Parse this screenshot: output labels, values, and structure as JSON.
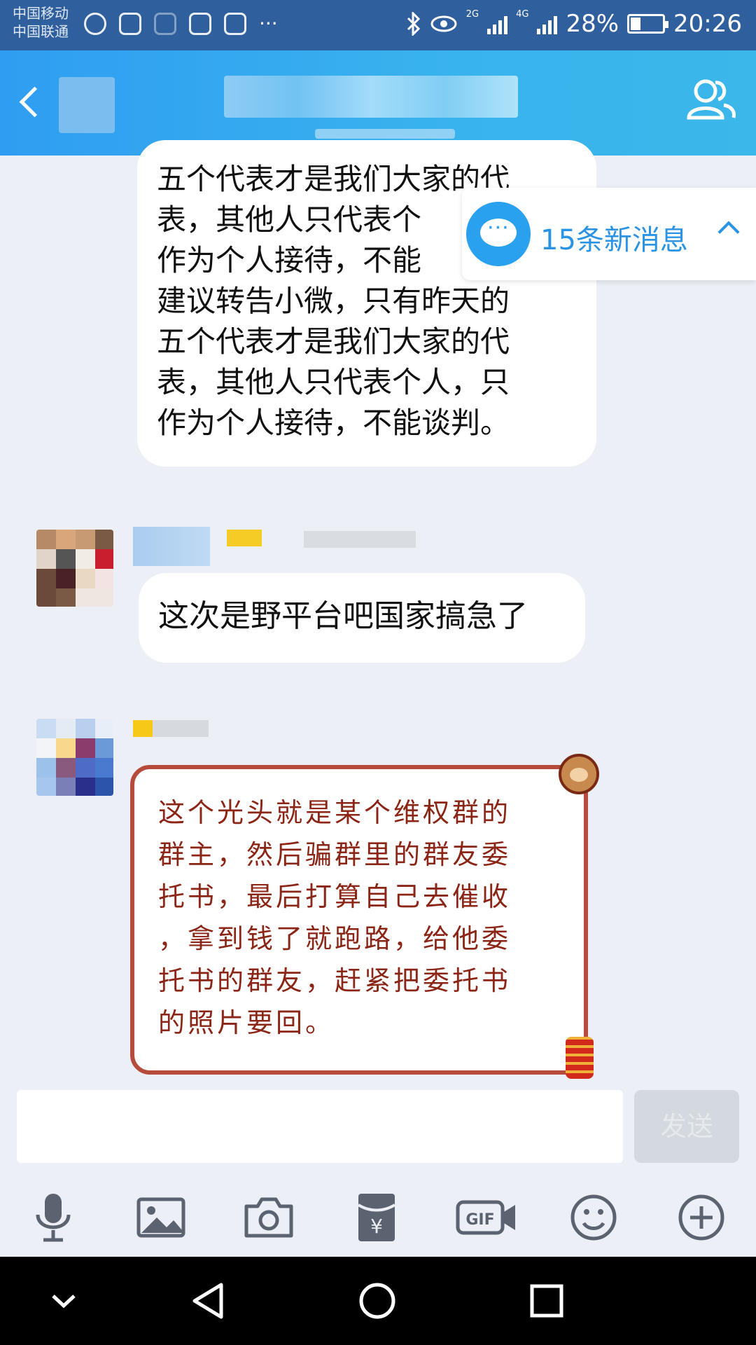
{
  "status_bar": {
    "carrier_1": "中国移动",
    "carrier_2": "中国联通",
    "network_1": "2G",
    "network_2": "4G",
    "battery": "28%",
    "time": "20:26"
  },
  "new_messages": {
    "label": "15条新消息"
  },
  "messages": [
    {
      "lines": [
        "五个代表才是我们大家的代",
        "表，其他人只代表个",
        "作为个人接待，不能",
        "建议转告小微，只有昨天的",
        "五个代表才是我们大家的代",
        "表，其他人只代表个人，只",
        "作为个人接待，不能谈判。"
      ]
    },
    {
      "text": "这次是野平台吧国家搞急了"
    },
    {
      "card_lines": [
        "这个光头就是某个维权群的",
        "群主，然后骗群里的群友委",
        "托书，最后打算自己去催收",
        "，拿到钱了就跑路，给他委",
        "托书的群友，赶紧把委托书",
        "的照片要回。"
      ]
    }
  ],
  "input": {
    "send_label": "发送"
  },
  "toolbar": {
    "icons": [
      "microphone-icon",
      "image-icon",
      "camera-icon",
      "red-packet-icon",
      "gif-icon",
      "emoji-icon",
      "plus-icon"
    ]
  },
  "colors": {
    "status_bar": "#305f9d",
    "title_bar": "#2f9df1",
    "accent": "#2a93e3",
    "card_border": "#b64b3b",
    "card_text": "#8b2515",
    "background": "#eceff6"
  }
}
